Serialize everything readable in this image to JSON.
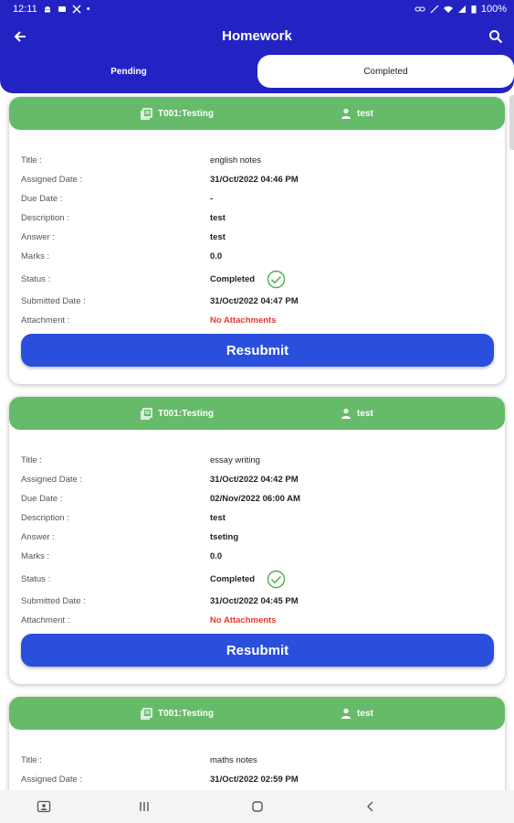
{
  "status_bar": {
    "time": "12:11",
    "battery": "100%"
  },
  "header": {
    "title": "Homework"
  },
  "tabs": [
    {
      "label": "Pending",
      "active": false
    },
    {
      "label": "Completed",
      "active": true
    }
  ],
  "labels": {
    "title": "Title :",
    "assigned": "Assigned Date :",
    "due": "Due Date :",
    "description": "Description :",
    "answer": "Answer :",
    "marks": "Marks :",
    "status": "Status :",
    "submitted": "Submitted Date :",
    "attachment": "Attachment :"
  },
  "resubmit_label": "Resubmit",
  "cards": [
    {
      "subject": "T001:Testing",
      "teacher": "test",
      "title": "english notes",
      "assigned": "31/Oct/2022 04:46 PM",
      "due": "-",
      "description": "test",
      "answer": "test",
      "marks": "0.0",
      "status": "Completed",
      "submitted": "31/Oct/2022 04:47 PM",
      "attachment": "No Attachments"
    },
    {
      "subject": "T001:Testing",
      "teacher": "test",
      "title": "essay writing",
      "assigned": "31/Oct/2022 04:42 PM",
      "due": "02/Nov/2022 06:00 AM",
      "description": "test",
      "answer": "tseting",
      "marks": "0.0",
      "status": "Completed",
      "submitted": "31/Oct/2022 04:45 PM",
      "attachment": "No Attachments"
    },
    {
      "subject": "T001:Testing",
      "teacher": "test",
      "title": "maths notes",
      "assigned": "31/Oct/2022 02:59 PM"
    }
  ],
  "colors": {
    "primary": "#2323c4",
    "card_header": "#66bb6a",
    "button": "#2a4fdc",
    "no_attachment": "#e53935",
    "check": "#4caf50"
  }
}
